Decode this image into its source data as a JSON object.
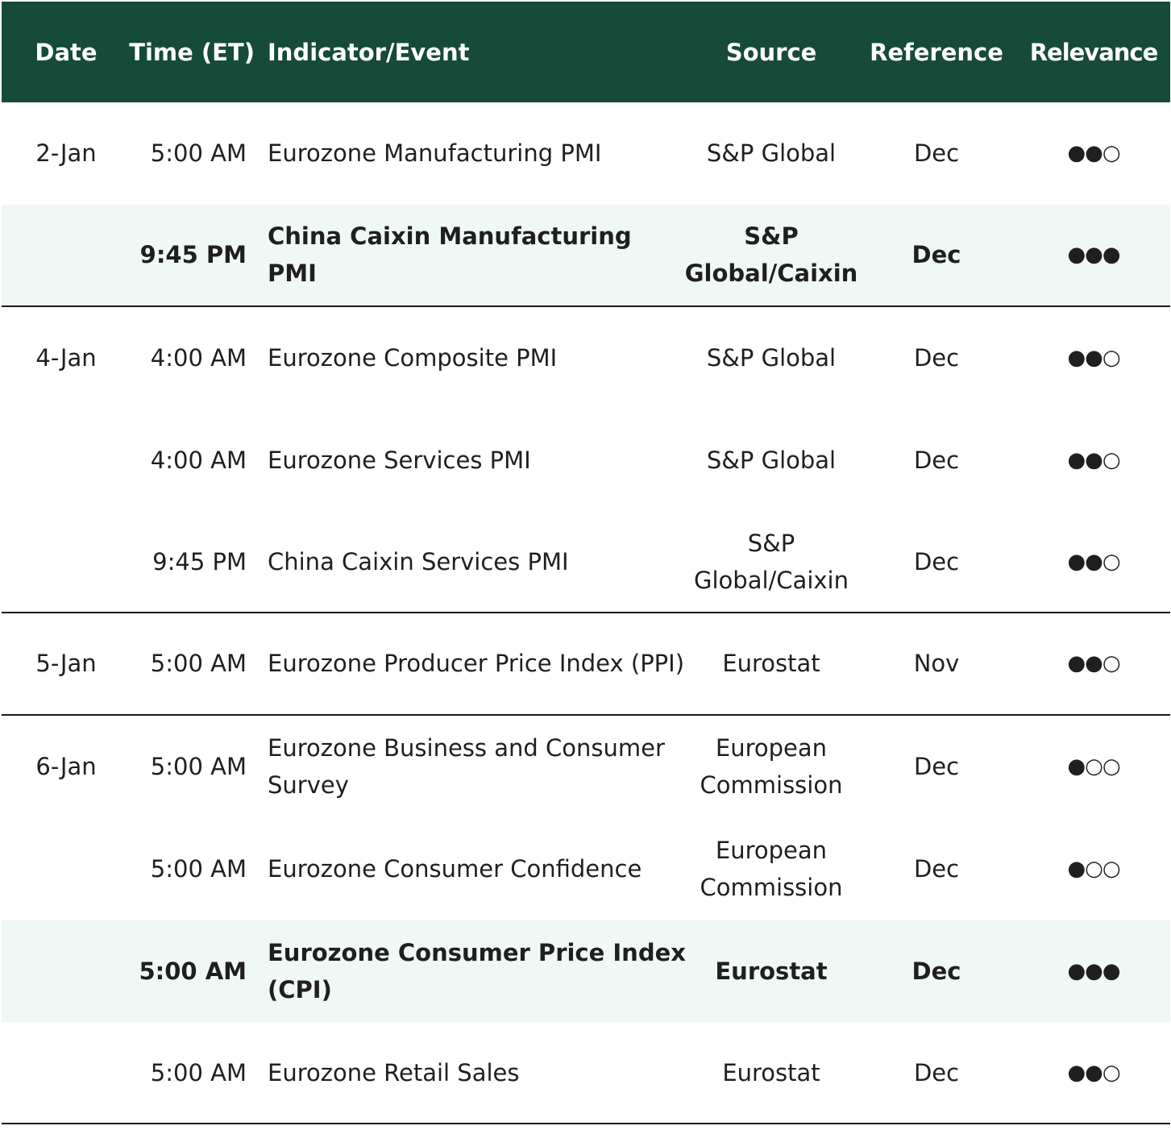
{
  "headers": {
    "date": "Date",
    "time": "Time (ET)",
    "indicator": "Indicator/Event",
    "source": "Source",
    "reference": "Reference",
    "relevance": "Relevance"
  },
  "rows": [
    {
      "date": "2-Jan",
      "time": "5:00 AM",
      "indicator": "Eurozone Manufacturing PMI",
      "source": "S&P Global",
      "reference": "Dec",
      "relevance": "●●○"
    },
    {
      "date": "",
      "time": "9:45 PM",
      "indicator": "China Caixin Manufacturing PMI",
      "source": "S&P Global/Caixin",
      "reference": "Dec",
      "relevance": "●●●"
    },
    {
      "date": "4-Jan",
      "time": "4:00 AM",
      "indicator": "Eurozone Composite PMI",
      "source": "S&P Global",
      "reference": "Dec",
      "relevance": "●●○"
    },
    {
      "date": "",
      "time": "4:00 AM",
      "indicator": "Eurozone Services PMI",
      "source": "S&P Global",
      "reference": "Dec",
      "relevance": "●●○"
    },
    {
      "date": "",
      "time": "9:45 PM",
      "indicator": "China Caixin Services PMI",
      "source": "S&P Global/Caixin",
      "reference": "Dec",
      "relevance": "●●○"
    },
    {
      "date": "5-Jan",
      "time": "5:00 AM",
      "indicator": "Eurozone Producer Price Index (PPI)",
      "source": "Eurostat",
      "reference": "Nov",
      "relevance": "●●○"
    },
    {
      "date": "6-Jan",
      "time": "5:00 AM",
      "indicator": "Eurozone Business and Consumer Survey",
      "source": "European Commission",
      "reference": "Dec",
      "relevance": "●○○"
    },
    {
      "date": "",
      "time": "5:00 AM",
      "indicator": "Eurozone Consumer Confidence",
      "source": "European Commission",
      "reference": "Dec",
      "relevance": "●○○"
    },
    {
      "date": "",
      "time": "5:00 AM",
      "indicator": "Eurozone Consumer Price Index (CPI)",
      "source": "Eurostat",
      "reference": "Dec",
      "relevance": "●●●"
    },
    {
      "date": "",
      "time": "5:00 AM",
      "indicator": "Eurozone Retail Sales",
      "source": "Eurostat",
      "reference": "Dec",
      "relevance": "●●○"
    }
  ],
  "colors": {
    "header_bg": "#154b38",
    "highlight_bg": "#eff8f5"
  }
}
